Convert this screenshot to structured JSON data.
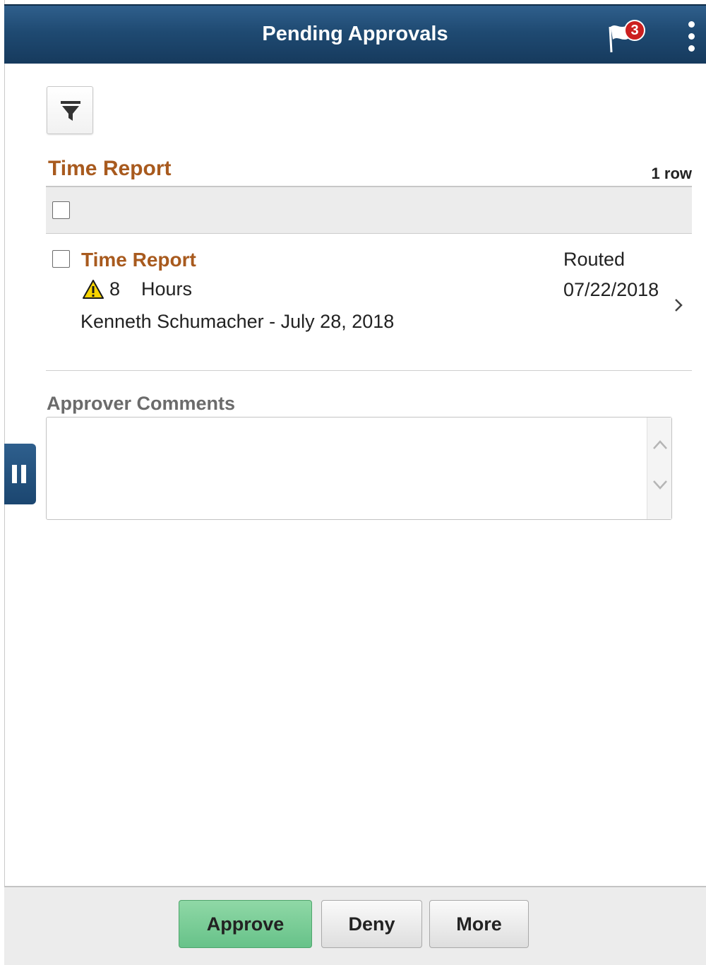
{
  "header": {
    "title": "Pending Approvals",
    "notifications_count": "3",
    "flag_icon": "flag-icon",
    "menu_icon": "kebab-menu-icon"
  },
  "toolbar": {
    "filter_icon": "filter-icon"
  },
  "section": {
    "title": "Time Report",
    "row_count": "1 row"
  },
  "items": [
    {
      "title": "Time Report",
      "quantity": "8",
      "unit": "Hours",
      "description": "Kenneth Schumacher - July 28, 2018",
      "status": "Routed",
      "date": "07/22/2018",
      "warning_icon": "warning-icon"
    }
  ],
  "comments": {
    "label": "Approver Comments",
    "value": ""
  },
  "footer": {
    "approve_label": "Approve",
    "deny_label": "Deny",
    "more_label": "More"
  },
  "colors": {
    "header": "#1f4a72",
    "accent_title": "#a85a1e",
    "approve": "#67c289",
    "badge": "#cc1f1f"
  }
}
